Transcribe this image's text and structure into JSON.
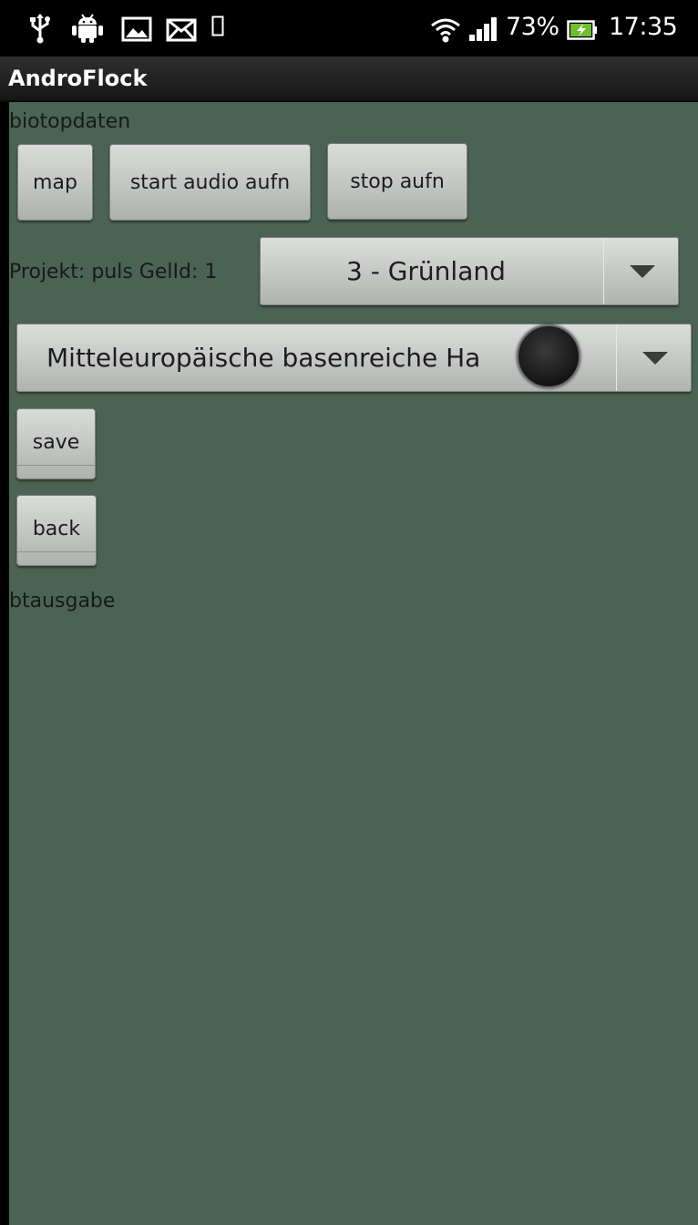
{
  "status_bar": {
    "battery_percent": "73%",
    "time": "17:35",
    "icons": [
      "usb-icon",
      "android-debug-icon",
      "image-icon",
      "mail-icon",
      "phone-icon",
      "wifi-icon",
      "signal-icon",
      "battery-charging-icon"
    ]
  },
  "app": {
    "title": "AndroFlock"
  },
  "main": {
    "header_label": "biotopdaten",
    "buttons": {
      "map": "map",
      "start_audio": "start audio aufn",
      "stop_audio": "stop aufn",
      "save": "save",
      "back": "back"
    },
    "project_label": "Projekt: puls GelId: 1",
    "category_spinner": {
      "selected": "3 - Grünland"
    },
    "biotope_spinner": {
      "selected": "Mitteleuropäische basenreiche Ha"
    },
    "output_label": "btausgabe"
  },
  "colors": {
    "background": "#4b6354",
    "status_bar": "#000000"
  }
}
